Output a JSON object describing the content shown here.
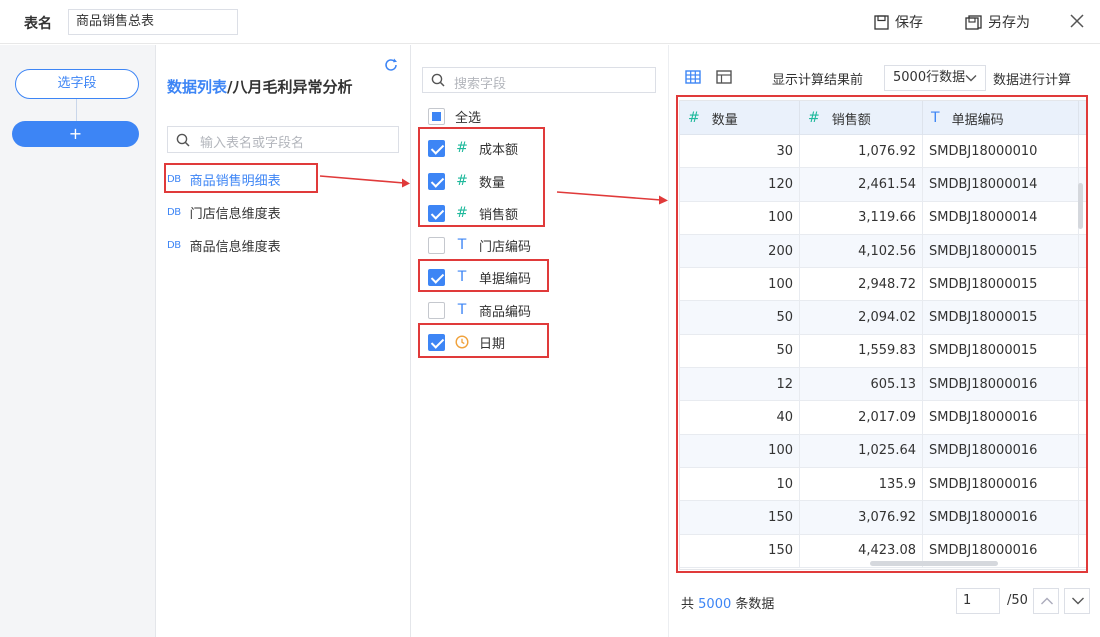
{
  "topbar": {
    "name_label": "表名",
    "name_value": "商品销售总表",
    "save_label": "保存",
    "save_as_label": "另存为"
  },
  "rail": {
    "select_fields_label": "选字段",
    "add_label": "+"
  },
  "data_list": {
    "title_prefix": "数据列表",
    "title_sep": "/",
    "title_path": "八月毛利异常分析",
    "search_placeholder": "输入表名或字段名",
    "tables": [
      {
        "label": "商品销售明细表",
        "tag": "DB",
        "active": true
      },
      {
        "label": "门店信息维度表",
        "tag": "DB",
        "active": false
      },
      {
        "label": "商品信息维度表",
        "tag": "DB",
        "active": false
      }
    ]
  },
  "fields": {
    "search_placeholder": "搜索字段",
    "select_all_label": "全选",
    "items": [
      {
        "label": "成本额",
        "type": "#",
        "checked": true
      },
      {
        "label": "数量",
        "type": "#",
        "checked": true
      },
      {
        "label": "销售额",
        "type": "#",
        "checked": true
      },
      {
        "label": "门店编码",
        "type": "T",
        "checked": false
      },
      {
        "label": "单据编码",
        "type": "T",
        "checked": true
      },
      {
        "label": "商品编码",
        "type": "T",
        "checked": false
      },
      {
        "label": "日期",
        "type": "date",
        "checked": true
      }
    ]
  },
  "preview": {
    "show_label": "显示计算结果前",
    "row_count_value": "5000",
    "row_count_suffix": "行数据",
    "compute_label": "数据进行计算",
    "columns": [
      {
        "type": "#",
        "label": "数量"
      },
      {
        "type": "#",
        "label": "销售额"
      },
      {
        "type": "T",
        "label": "单据编码"
      }
    ],
    "rows": [
      [
        "30",
        "1,076.92",
        "SMDBJ18000010"
      ],
      [
        "120",
        "2,461.54",
        "SMDBJ18000014"
      ],
      [
        "100",
        "3,119.66",
        "SMDBJ18000014"
      ],
      [
        "200",
        "4,102.56",
        "SMDBJ18000015"
      ],
      [
        "100",
        "2,948.72",
        "SMDBJ18000015"
      ],
      [
        "50",
        "2,094.02",
        "SMDBJ18000015"
      ],
      [
        "50",
        "1,559.83",
        "SMDBJ18000015"
      ],
      [
        "12",
        "605.13",
        "SMDBJ18000016"
      ],
      [
        "40",
        "2,017.09",
        "SMDBJ18000016"
      ],
      [
        "100",
        "1,025.64",
        "SMDBJ18000016"
      ],
      [
        "10",
        "135.9",
        "SMDBJ18000016"
      ],
      [
        "150",
        "3,076.92",
        "SMDBJ18000016"
      ],
      [
        "150",
        "4,423.08",
        "SMDBJ18000016"
      ]
    ],
    "footer_prefix": "共",
    "footer_count": "5000",
    "footer_suffix": "条数据",
    "page_value": "1",
    "page_total": "/50"
  },
  "colors": {
    "accent": "#3d85f5",
    "number_type": "#1fb99c",
    "annotation": "#e03a3a"
  }
}
